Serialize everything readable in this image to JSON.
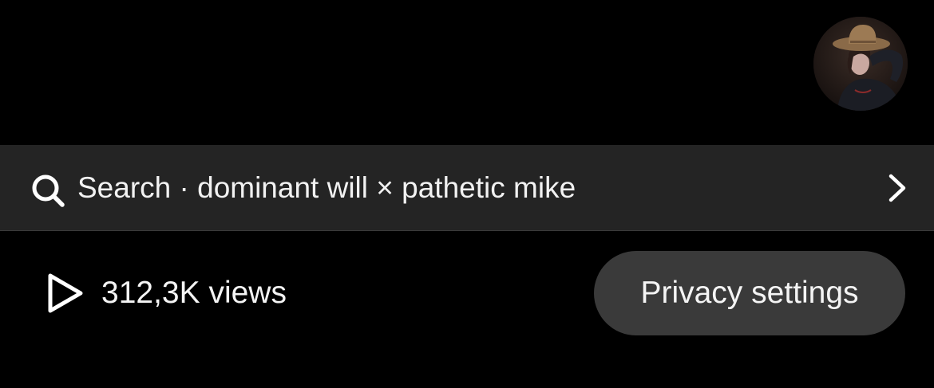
{
  "header": {
    "avatar_icon": "user-avatar"
  },
  "search_bar": {
    "icon": "search-icon",
    "text": "Search · dominant will × pathetic mike",
    "chevron_icon": "chevron-right-icon"
  },
  "stats": {
    "icon": "play-icon",
    "views_text": "312,3K views"
  },
  "actions": {
    "privacy_label": "Privacy settings"
  },
  "colors": {
    "background": "#000000",
    "search_bar_bg": "#242424",
    "button_bg": "#3a3a3a",
    "text": "#ffffff"
  }
}
